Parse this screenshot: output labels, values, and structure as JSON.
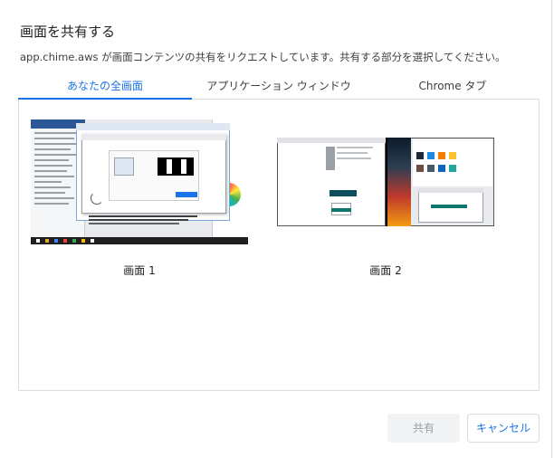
{
  "dialog": {
    "title": "画面を共有する",
    "subtitle": "app.chime.aws が画面コンテンツの共有をリクエストしています。共有する部分を選択してください。"
  },
  "tabs": [
    {
      "label": "あなたの全画面",
      "active": true
    },
    {
      "label": "アプリケーション ウィンドウ",
      "active": false
    },
    {
      "label": "Chrome タブ",
      "active": false
    }
  ],
  "screens": [
    {
      "label": "画面 1",
      "selected": false
    },
    {
      "label": "画面 2",
      "selected": false
    }
  ],
  "buttons": {
    "share": "共有",
    "cancel": "キャンセル"
  },
  "colors": {
    "accent": "#1a73e8",
    "border": "#dadce0",
    "disabled_bg": "#f1f3f4",
    "disabled_text": "#9aa0a6"
  }
}
